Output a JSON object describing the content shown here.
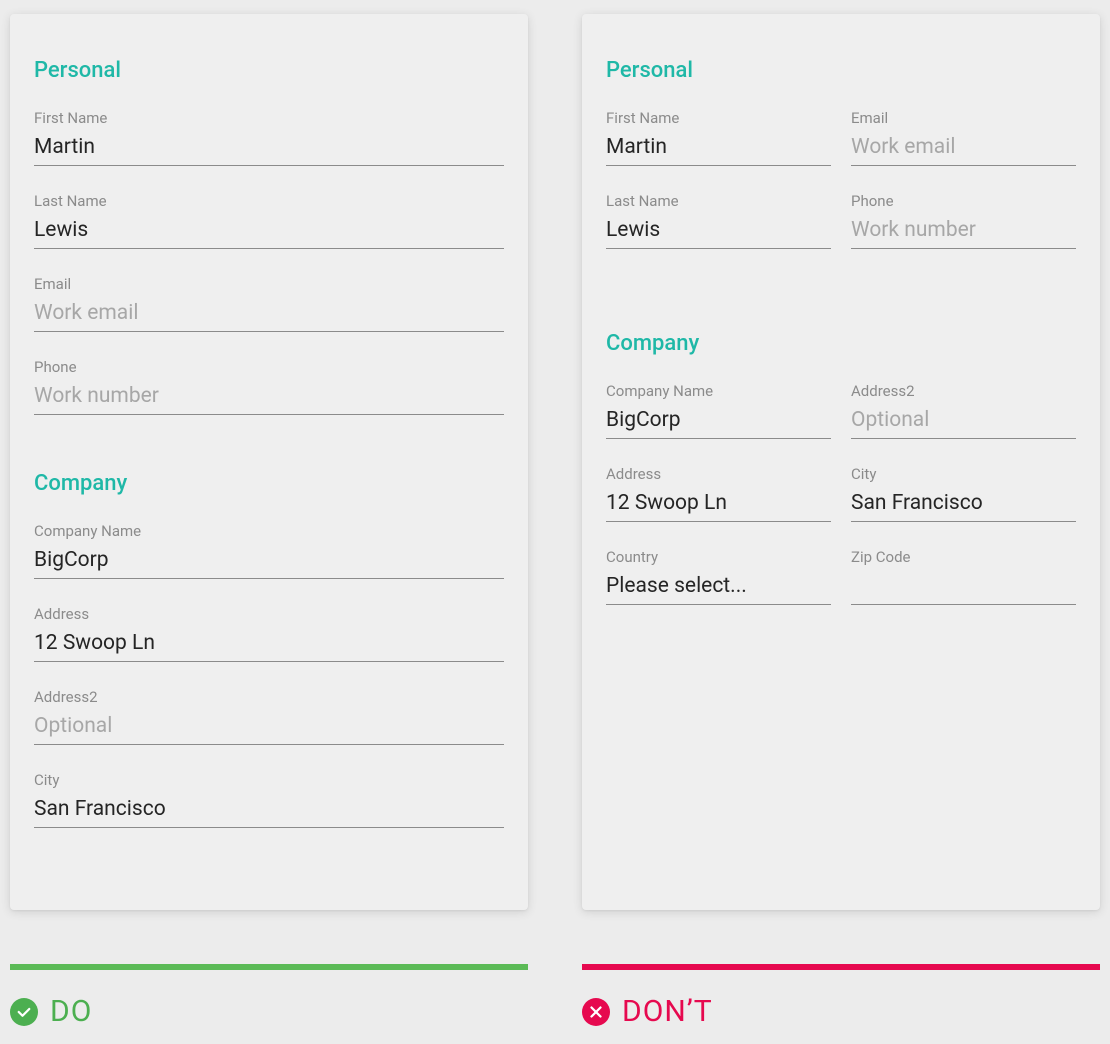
{
  "left": {
    "personal": {
      "title": "Personal",
      "first_name_label": "First Name",
      "first_name_value": "Martin",
      "last_name_label": "Last Name",
      "last_name_value": "Lewis",
      "email_label": "Email",
      "email_placeholder": "Work email",
      "phone_label": "Phone",
      "phone_placeholder": "Work number"
    },
    "company": {
      "title": "Company",
      "company_name_label": "Company Name",
      "company_name_value": "BigCorp",
      "address_label": "Address",
      "address_value": "12 Swoop Ln",
      "address2_label": "Address2",
      "address2_placeholder": "Optional",
      "city_label": "City",
      "city_value": "San Francisco"
    }
  },
  "right": {
    "personal": {
      "title": "Personal",
      "first_name_label": "First Name",
      "first_name_value": "Martin",
      "email_label": "Email",
      "email_placeholder": "Work email",
      "last_name_label": "Last Name",
      "last_name_value": "Lewis",
      "phone_label": "Phone",
      "phone_placeholder": "Work number"
    },
    "company": {
      "title": "Company",
      "company_name_label": "Company Name",
      "company_name_value": "BigCorp",
      "address2_label": "Address2",
      "address2_placeholder": "Optional",
      "address_label": "Address",
      "address_value": "12 Swoop Ln",
      "city_label": "City",
      "city_value": "San Francisco",
      "country_label": "Country",
      "country_value": "Please select...",
      "zip_label": "Zip Code"
    }
  },
  "footer": {
    "do_label": "DO",
    "dont_label": "DON’T"
  }
}
